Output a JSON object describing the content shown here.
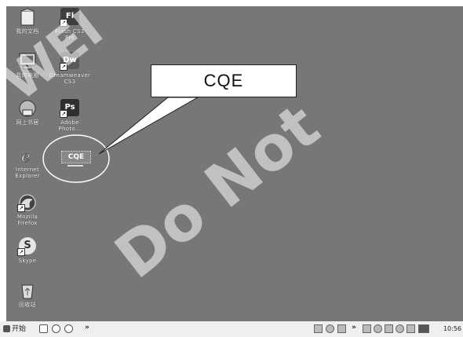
{
  "desktop": {
    "icons": [
      {
        "id": "documents",
        "label": "我的文档",
        "icon": "my-documents-icon",
        "color": "#d8d8d8"
      },
      {
        "id": "flash",
        "label": "Flash CS3\nPro",
        "icon": "flash-cs3-icon",
        "color": "#4a4a4a",
        "glyph": "Fl"
      },
      {
        "id": "computer",
        "label": "我的电脑",
        "icon": "my-computer-icon",
        "color": "#9a9a9a"
      },
      {
        "id": "dreamweaver",
        "label": "Dreamweaver\nCS3",
        "icon": "dreamweaver-icon",
        "color": "#5a5a5a",
        "glyph": "Dw"
      },
      {
        "id": "network",
        "label": "网上邻居",
        "icon": "network-places-icon",
        "color": "#bbbbbb"
      },
      {
        "id": "photoshop",
        "label": "Adobe\nPhoto...",
        "icon": "photoshop-icon",
        "color": "#3a3a3a",
        "glyph": "Ps"
      },
      {
        "id": "ie",
        "label": "Internet\nExplorer",
        "icon": "internet-explorer-icon",
        "color": "#e0e0e0"
      },
      {
        "id": "firefox",
        "label": "Mozilla\nFirefox",
        "icon": "firefox-icon",
        "color": "#d0d0d0"
      },
      {
        "id": "skype",
        "label": "Skype",
        "icon": "skype-icon",
        "color": "#bdbdbd",
        "glyph": "S"
      },
      {
        "id": "recycle",
        "label": "回收站",
        "icon": "recycle-bin-icon",
        "color": "#e8e8e8"
      }
    ],
    "cqe_icon": {
      "label": "CQE",
      "icon": "cqe-app-icon"
    }
  },
  "callout": {
    "text": "CQE"
  },
  "watermark": {
    "lines": [
      "WEI",
      "Do Not"
    ]
  },
  "taskbar": {
    "start_label": "开始",
    "quicklaunch": [
      "show-desktop-icon",
      "ie-quicklaunch-icon",
      "media-player-icon"
    ],
    "chevron": "»",
    "tray_icons": [
      "tray-icon-1",
      "tray-icon-2",
      "tray-icon-3",
      "tray-icon-4",
      "tray-icon-5",
      "tray-icon-6",
      "tray-icon-7",
      "tray-icon-8",
      "tray-icon-9"
    ],
    "clock": "10:56"
  }
}
